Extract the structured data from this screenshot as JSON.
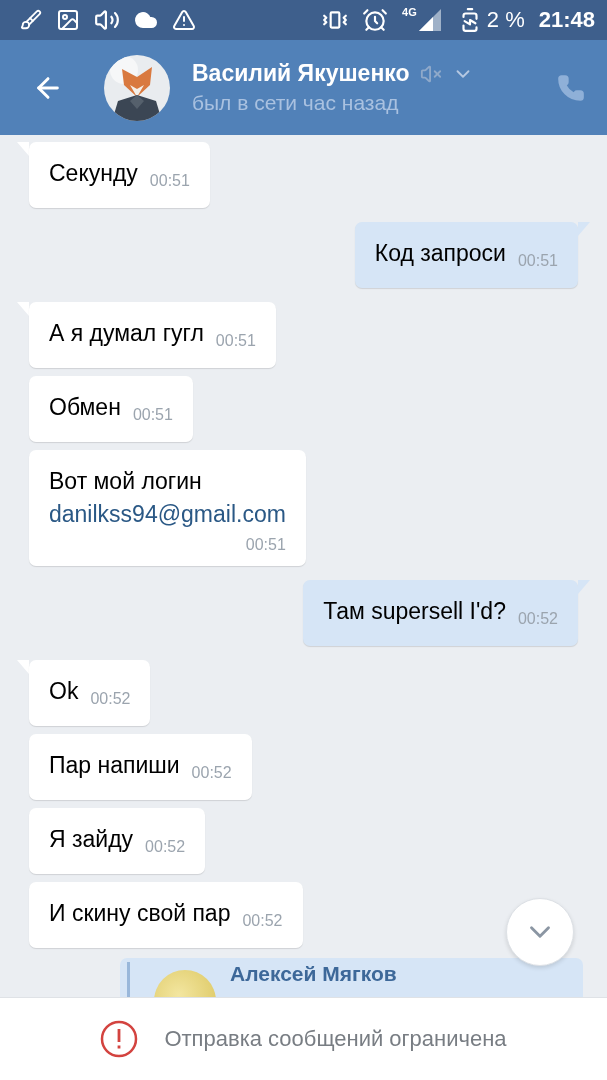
{
  "status_bar": {
    "network": "4G",
    "battery": "2 %",
    "time": "21:48"
  },
  "header": {
    "name": "Василий Якушенко",
    "status": "был в сети час назад",
    "muted": true
  },
  "messages": [
    {
      "outgoing": false,
      "tail": true,
      "text": "Секунду",
      "time": "00:51"
    },
    {
      "outgoing": true,
      "tail": true,
      "text": "Код запроси",
      "time": "00:51"
    },
    {
      "outgoing": false,
      "tail": true,
      "text": "А я думал гугл",
      "time": "00:51"
    },
    {
      "outgoing": false,
      "tail": false,
      "text": "Обмен",
      "time": "00:51"
    },
    {
      "outgoing": false,
      "tail": false,
      "text": "Вот мой логин",
      "link": "danilkss94@gmail.com",
      "time": "00:51"
    },
    {
      "outgoing": true,
      "tail": true,
      "text": "Там supersell I'd?",
      "time": "00:52"
    },
    {
      "outgoing": false,
      "tail": true,
      "text": "Ok",
      "time": "00:52"
    },
    {
      "outgoing": false,
      "tail": false,
      "text": "Пар напиши",
      "time": "00:52"
    },
    {
      "outgoing": false,
      "tail": false,
      "text": "Я зайду",
      "time": "00:52"
    },
    {
      "outgoing": false,
      "tail": false,
      "text": "И скину свой пар",
      "time": "00:52"
    }
  ],
  "forwarded": {
    "author": "Алексей Мягков"
  },
  "notice": "Отправка сообщений ограничена"
}
